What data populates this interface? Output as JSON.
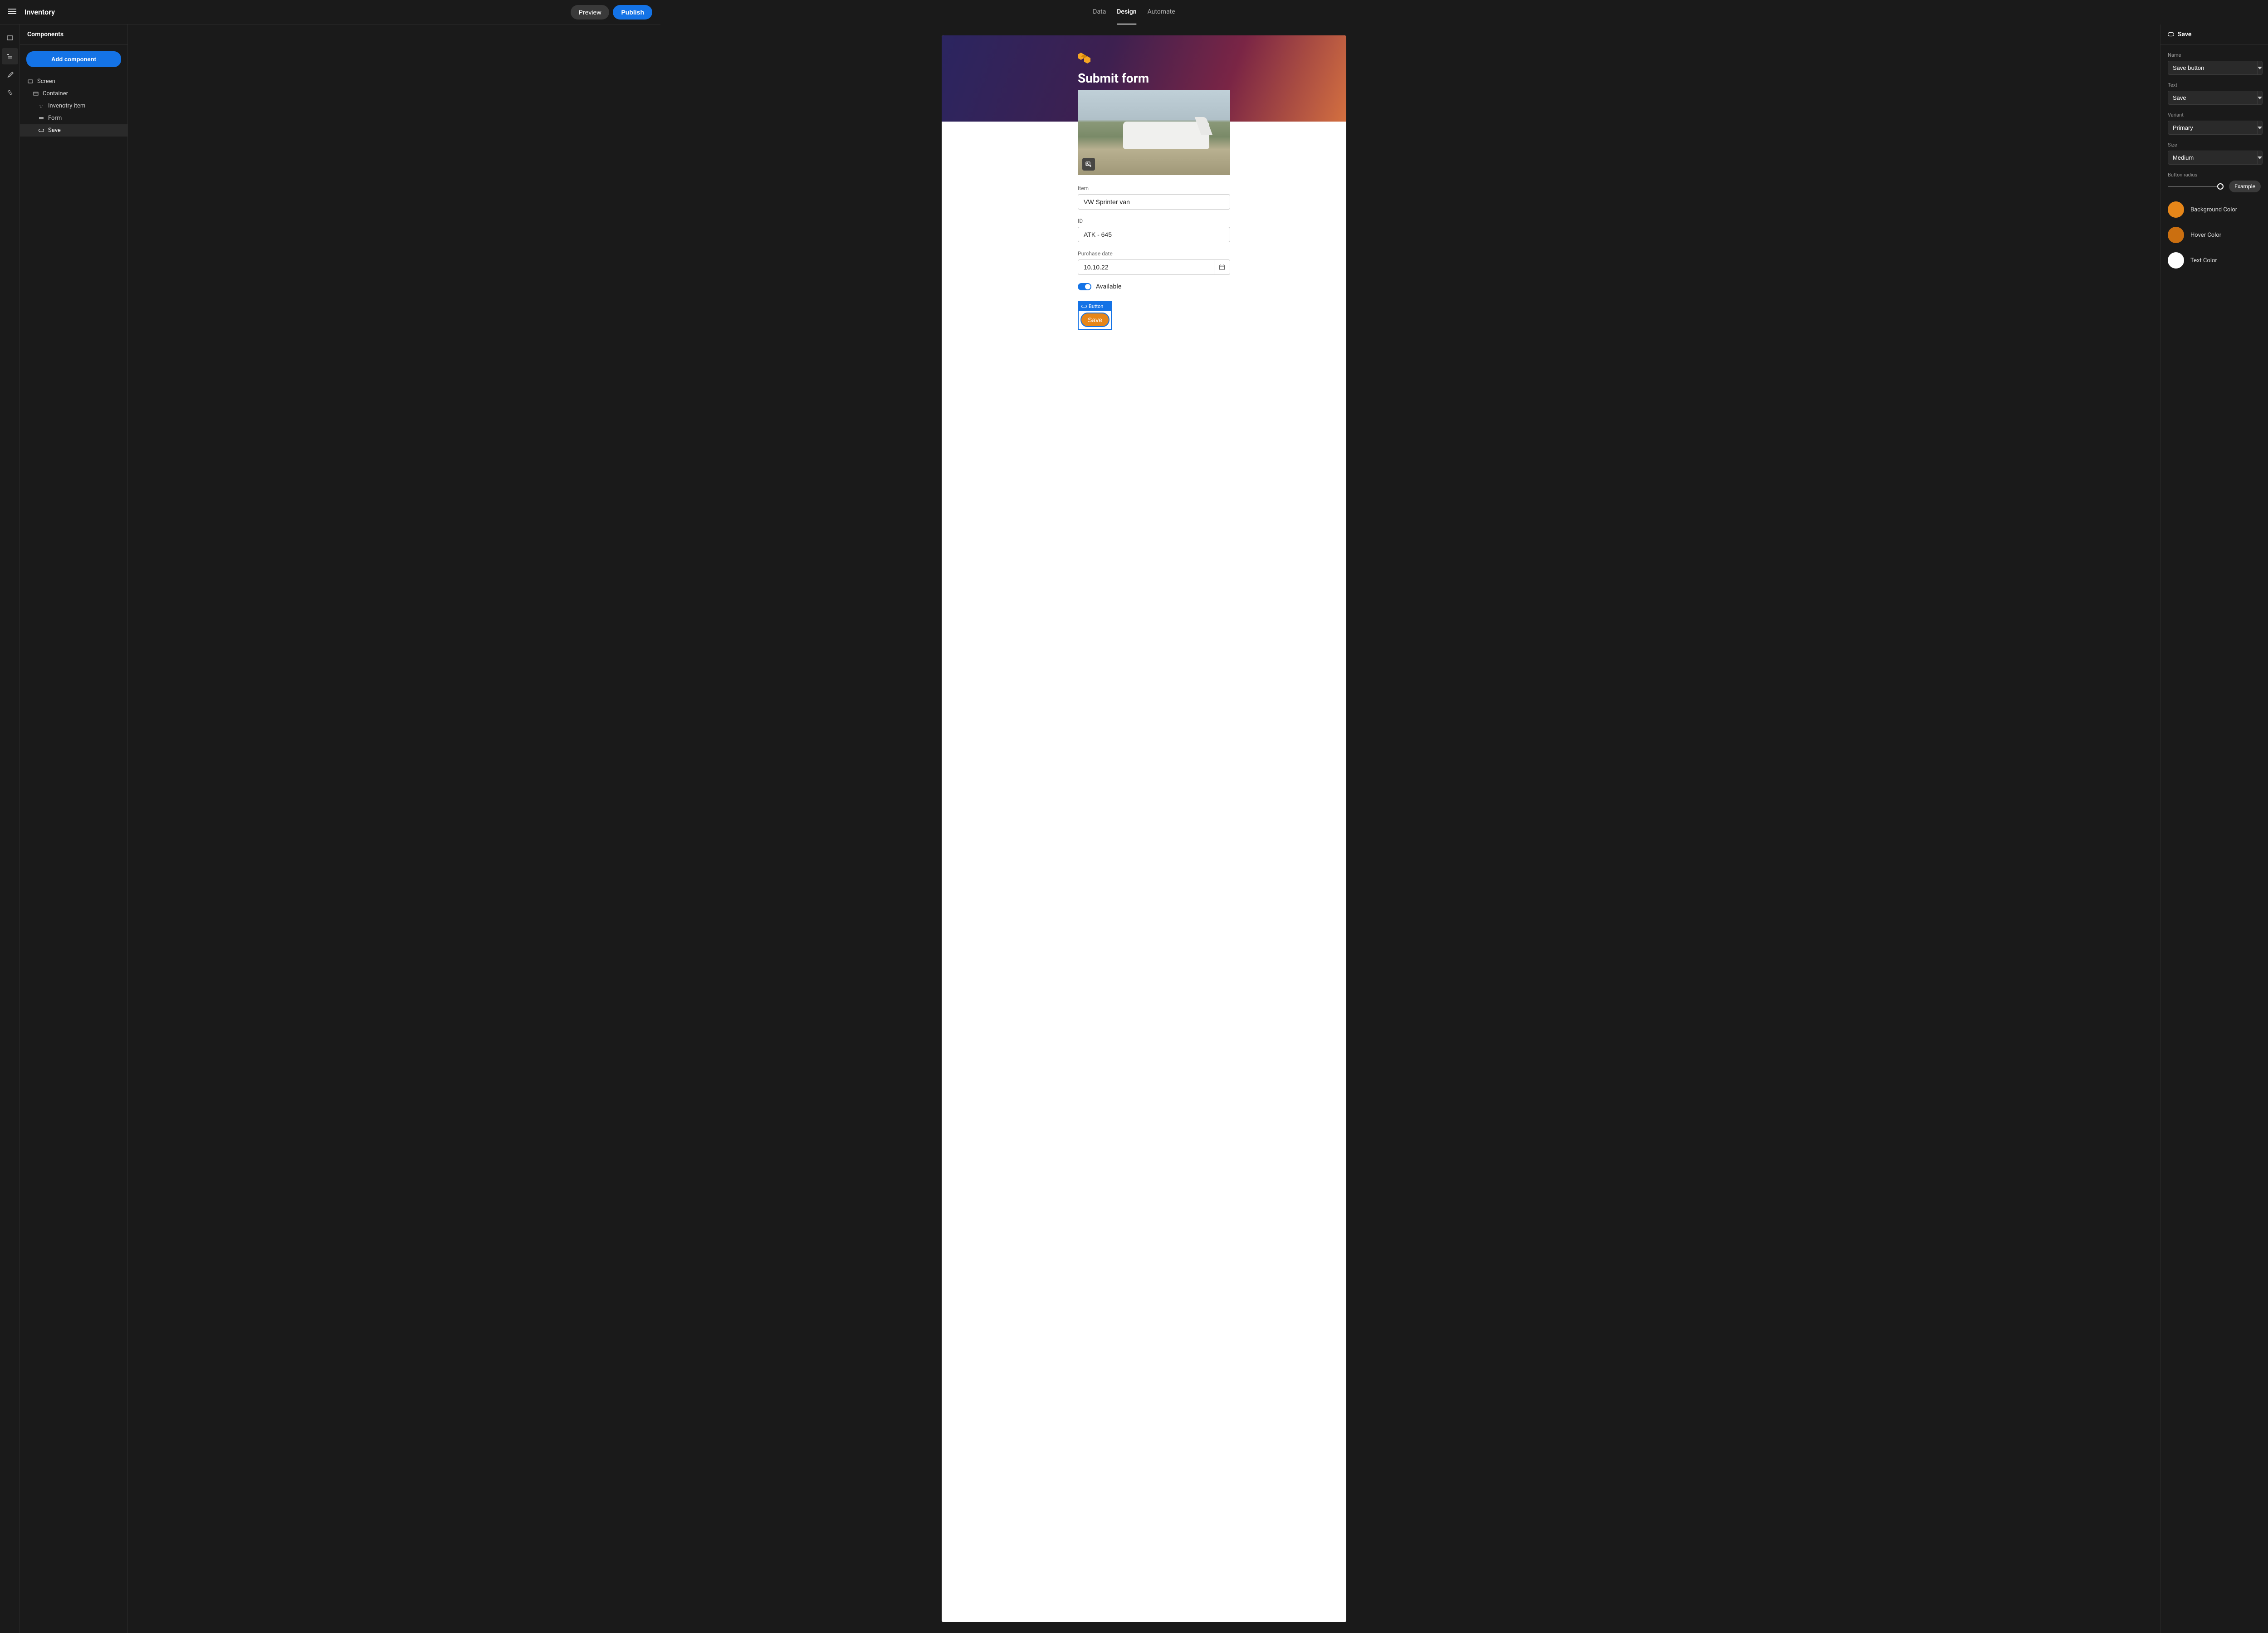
{
  "app_title": "Inventory",
  "top_nav": {
    "data": "Data",
    "design": "Design",
    "automate": "Automate"
  },
  "top_actions": {
    "preview": "Preview",
    "publish": "Publish"
  },
  "components_panel": {
    "header": "Components",
    "add_button": "Add component",
    "tree": {
      "screen": "Screen",
      "container": "Container",
      "inventory_item": "Invenotry item",
      "form": "Form",
      "save": "Save"
    }
  },
  "canvas": {
    "hero_title": "Submit form",
    "form": {
      "item_label": "Item",
      "item_value": "VW Sprinter van",
      "id_label": "ID",
      "id_value": "ATK - 645",
      "date_label": "Purchase date",
      "date_value": "10.10.22",
      "available_label": "Available",
      "button_tag": "Button",
      "save_label": "Save"
    }
  },
  "right_panel": {
    "header": "Save",
    "name_label": "Name",
    "name_value": "Save button",
    "text_label": "Text",
    "text_value": "Save",
    "variant_label": "Variant",
    "variant_value": "Primary",
    "size_label": "Size",
    "size_value": "Medium",
    "radius_label": "Button radius",
    "example_chip": "Example",
    "bg_color_label": "Background Color",
    "bg_color": "#e68619",
    "hover_color_label": "Hover Color",
    "hover_color": "#cb6f10",
    "text_color_label": "Text Color",
    "text_color": "#ffffff"
  }
}
